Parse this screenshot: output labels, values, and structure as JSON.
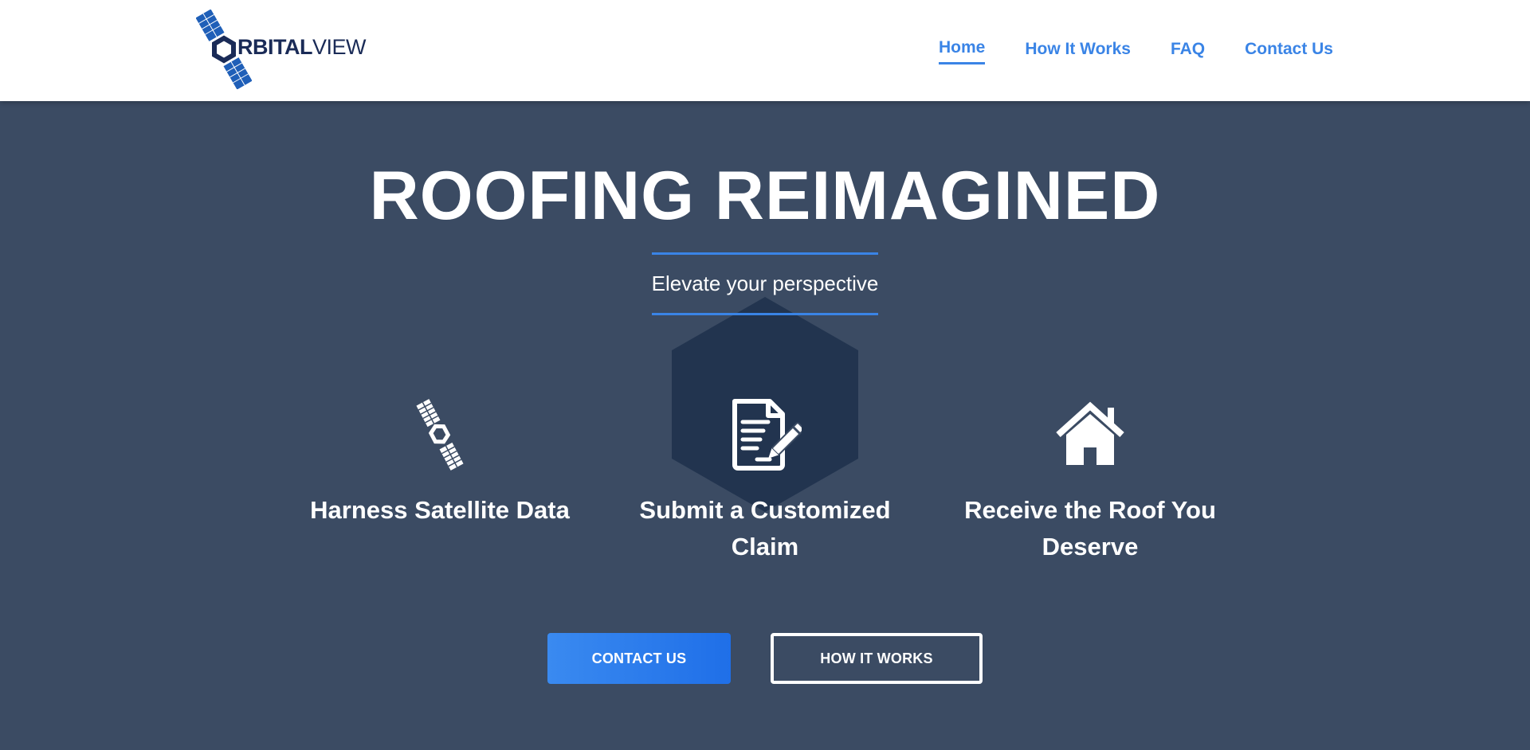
{
  "brand": {
    "logo_bold": "RBITAL",
    "logo_thin": "VIEW",
    "logo_icon": "satellite-icon",
    "colors": {
      "navy": "#1a2b57",
      "blue": "#1f5fb8"
    }
  },
  "nav": {
    "items": [
      {
        "label": "Home",
        "active": true
      },
      {
        "label": "How It Works",
        "active": false
      },
      {
        "label": "FAQ",
        "active": false
      },
      {
        "label": "Contact Us",
        "active": false
      }
    ],
    "color": "#3a84e6"
  },
  "hero": {
    "title": "ROOFING REIMAGINED",
    "subtitle": "Elevate your perspective",
    "background": "#3b4b63",
    "hexagon_color": "#22344f"
  },
  "features": [
    {
      "icon": "satellite-icon",
      "label": "Harness Satellite Data"
    },
    {
      "icon": "document-pen-icon",
      "label": "Submit a Customized Claim"
    },
    {
      "icon": "house-icon",
      "label": "Receive the Roof You Deserve"
    }
  ],
  "buttons": {
    "primary": "CONTACT US",
    "secondary": "HOW IT WORKS"
  }
}
